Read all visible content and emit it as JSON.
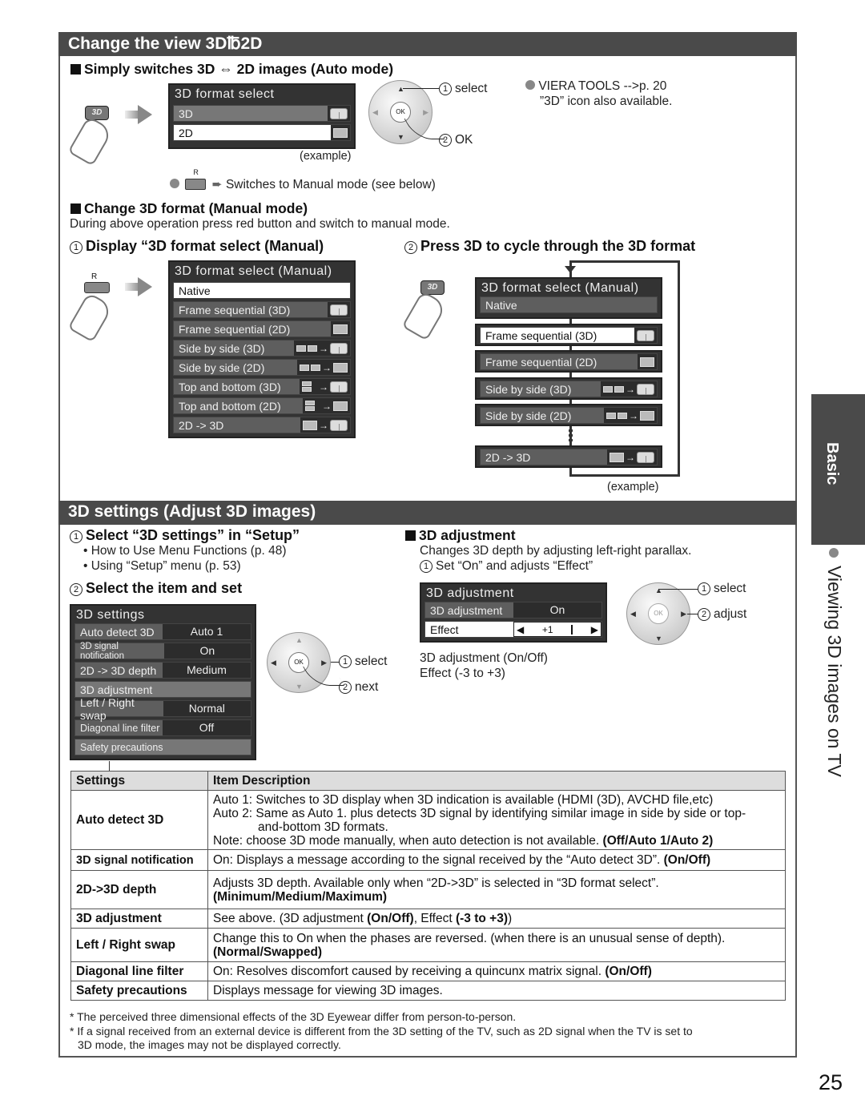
{
  "section1": {
    "title": "Change the view 3D℔2D",
    "auto": {
      "heading": "Simply switches 3D ⇔ 2D images (Auto mode)",
      "remote_button": "3D",
      "osd": {
        "title": "3D format select",
        "items": [
          {
            "label": "3D",
            "icon": "cube-3d-icon",
            "state": "highlight"
          },
          {
            "label": "2D",
            "icon": "flat-2d-icon",
            "state": "selected"
          }
        ]
      },
      "example_label": "(example)",
      "dpad": {
        "ok": "OK",
        "step1": "select",
        "step2": "OK"
      },
      "note_bullet": "VIERA TOOLS -->p. 20",
      "note_line2": "”3D” icon also available.",
      "red_button_label": "R",
      "red_button_note": "Switches to Manual mode (see below)"
    },
    "manual": {
      "heading": "Change 3D format (Manual mode)",
      "description": "During above operation press red button and switch to manual mode.",
      "step1_num": "1",
      "step1": "Display “3D format select (Manual)",
      "step2_num": "2",
      "step2": "Press 3D to cycle through the 3D format",
      "red_button_label": "R",
      "osd": {
        "title": "3D format select (Manual)",
        "items": [
          {
            "label": "Native",
            "icon": ""
          },
          {
            "label": "Frame sequential (3D)",
            "icon": "cube-3d-icon"
          },
          {
            "label": "Frame sequential (2D)",
            "icon": "flat-2d-icon"
          },
          {
            "label": "Side by side (3D)",
            "icon": "side-by-side-to-3d-icon"
          },
          {
            "label": "Side by side (2D)",
            "icon": "side-by-side-to-2d-icon"
          },
          {
            "label": "Top and bottom (3D)",
            "icon": "top-bottom-to-3d-icon"
          },
          {
            "label": "Top and bottom (2D)",
            "icon": "top-bottom-to-2d-icon"
          },
          {
            "label": "2D -> 3D",
            "icon": "2d-to-3d-icon"
          }
        ]
      },
      "cycle": {
        "title": "3D format select (Manual)",
        "items": [
          {
            "label": "Native"
          },
          {
            "label": "Frame sequential (3D)"
          },
          {
            "label": "Frame sequential (2D)"
          },
          {
            "label": "Side by side (3D)"
          },
          {
            "label": "Side by side (2D)"
          },
          {
            "label": "2D -> 3D"
          }
        ],
        "example_label": "(example)"
      }
    }
  },
  "section2": {
    "title": "3D settings (Adjust 3D images)",
    "step1_num": "1",
    "step1": "Select “3D settings” in “Setup”",
    "step1_bullets": [
      "How to Use Menu Functions (p. 48)",
      "Using “Setup” menu (p. 53)"
    ],
    "step2_num": "2",
    "step2": "Select the item and set",
    "osd": {
      "title": "3D settings",
      "rows": [
        {
          "label": "Auto detect 3D",
          "value": "Auto 1"
        },
        {
          "label": "3D signal notification",
          "value": "On"
        },
        {
          "label": "2D -> 3D depth",
          "value": "Medium"
        },
        {
          "label": "3D adjustment",
          "value": ""
        },
        {
          "label": "Left / Right swap",
          "value": "Normal"
        },
        {
          "label": "Diagonal line filter",
          "value": "Off"
        },
        {
          "label": "Safety precautions",
          "value": ""
        }
      ]
    },
    "dpad": {
      "ok": "OK",
      "step1": "select",
      "step2": "next"
    },
    "adjustment": {
      "heading": "3D adjustment",
      "description": "Changes 3D depth by adjusting left-right parallax.",
      "step_num": "1",
      "step": "Set “On” and adjusts “Effect”",
      "osd": {
        "title": "3D adjustment",
        "row1_label": "3D adjustment",
        "row1_value": "On",
        "row2_label": "Effect",
        "row2_value": "+1",
        "effect_level": 1,
        "effect_range": [
          -3,
          3
        ]
      },
      "dpad": {
        "ok": "OK",
        "step1": "select",
        "step2": "adjust"
      },
      "range_line1": "3D adjustment (On/Off)",
      "range_line2": "Effect (-3 to +3)"
    },
    "table": {
      "headers": [
        "Settings",
        "Item Description"
      ],
      "rows": [
        {
          "setting": "Auto detect 3D",
          "lines": [
            "Auto 1: Switches to 3D display when 3D indication is available (HDMI (3D), AVCHD file,etc)",
            "Auto 2: Same as Auto 1. plus detects 3D signal by identifying similar image in side by side or top-",
            "and-bottom 3D formats.",
            "Note: choose 3D mode manually, when auto detection is not available. "
          ],
          "options": "(Off/Auto 1/Auto 2)"
        },
        {
          "setting": "3D signal notification",
          "lines": [
            "On: Displays a message according to the signal received by the “Auto detect 3D”. "
          ],
          "options": "(On/Off)"
        },
        {
          "setting": "2D->3D depth",
          "lines": [
            "Adjusts 3D depth. Available only when “2D->3D” is selected in “3D format select”."
          ],
          "options": "(Minimum/Medium/Maximum)"
        },
        {
          "setting": "3D adjustment",
          "lines": [
            "See above. (3D adjustment "
          ],
          "options": "(On/Off)",
          "mid": ", Effect ",
          "options2": "(-3 to +3)",
          "tail": ")"
        },
        {
          "setting": "Left / Right swap",
          "lines": [
            "Change this to On when the phases are reversed. (when there is an unusual sense of depth)."
          ],
          "options": "(Normal/Swapped)"
        },
        {
          "setting": "Diagonal line filter",
          "lines": [
            "On: Resolves discomfort caused by receiving a quincunx matrix signal. "
          ],
          "options": "(On/Off)"
        },
        {
          "setting": "Safety precautions",
          "lines": [
            "Displays message for viewing 3D images."
          ],
          "options": ""
        }
      ]
    },
    "footnotes": [
      "* The perceived three dimensional effects of the 3D Eyewear differ from person-to-person.",
      "* If a signal received from an external device is different from the 3D setting of the TV, such as 2D signal when the TV is set to",
      "3D mode, the images may not be displayed correctly."
    ]
  },
  "side": {
    "tab": "Basic",
    "title": "Viewing 3D images on TV"
  },
  "page_number": "25"
}
